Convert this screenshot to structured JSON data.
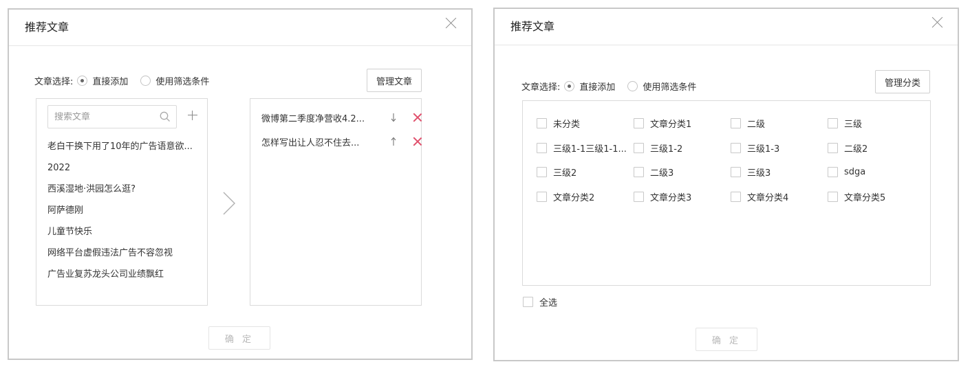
{
  "left_dialog": {
    "title": "推荐文章",
    "selection_label": "文章选择:",
    "radio_direct": "直接添加",
    "radio_filter": "使用筛选条件",
    "manage_button": "管理文章",
    "search_placeholder": "搜索文章",
    "articles": [
      "老白干换下用了10年的广告语意欲...",
      "2022",
      "西溪湿地·洪园怎么逛?",
      "阿萨德刚",
      "儿童节快乐",
      "网络平台虚假违法广告不容忽视",
      "广告业复苏龙头公司业绩飘红"
    ],
    "selected_articles": [
      {
        "title": "微博第二季度净营收4.2...",
        "move": "down-arrow-icon"
      },
      {
        "title": "怎样写出让人忍不住去...",
        "move": "up-arrow-icon"
      }
    ],
    "confirm_button": "确 定"
  },
  "right_dialog": {
    "title": "推荐文章",
    "selection_label": "文章选择:",
    "radio_direct": "直接添加",
    "radio_filter": "使用筛选条件",
    "manage_button": "管理分类",
    "categories": [
      "未分类",
      "文章分类1",
      "二级",
      "三级",
      "三级1-1三级1-1...",
      "三级1-2",
      "三级1-3",
      "二级2",
      "三级2",
      "二级3",
      "三级3",
      "sdga",
      "文章分类2",
      "文章分类3",
      "文章分类4",
      "文章分类5"
    ],
    "select_all_label": "全选",
    "confirm_button": "确 定"
  },
  "colors": {
    "delete_icon": "#e0506c",
    "border": "#c8c8c8",
    "disabled_text": "#b8b8b8"
  }
}
